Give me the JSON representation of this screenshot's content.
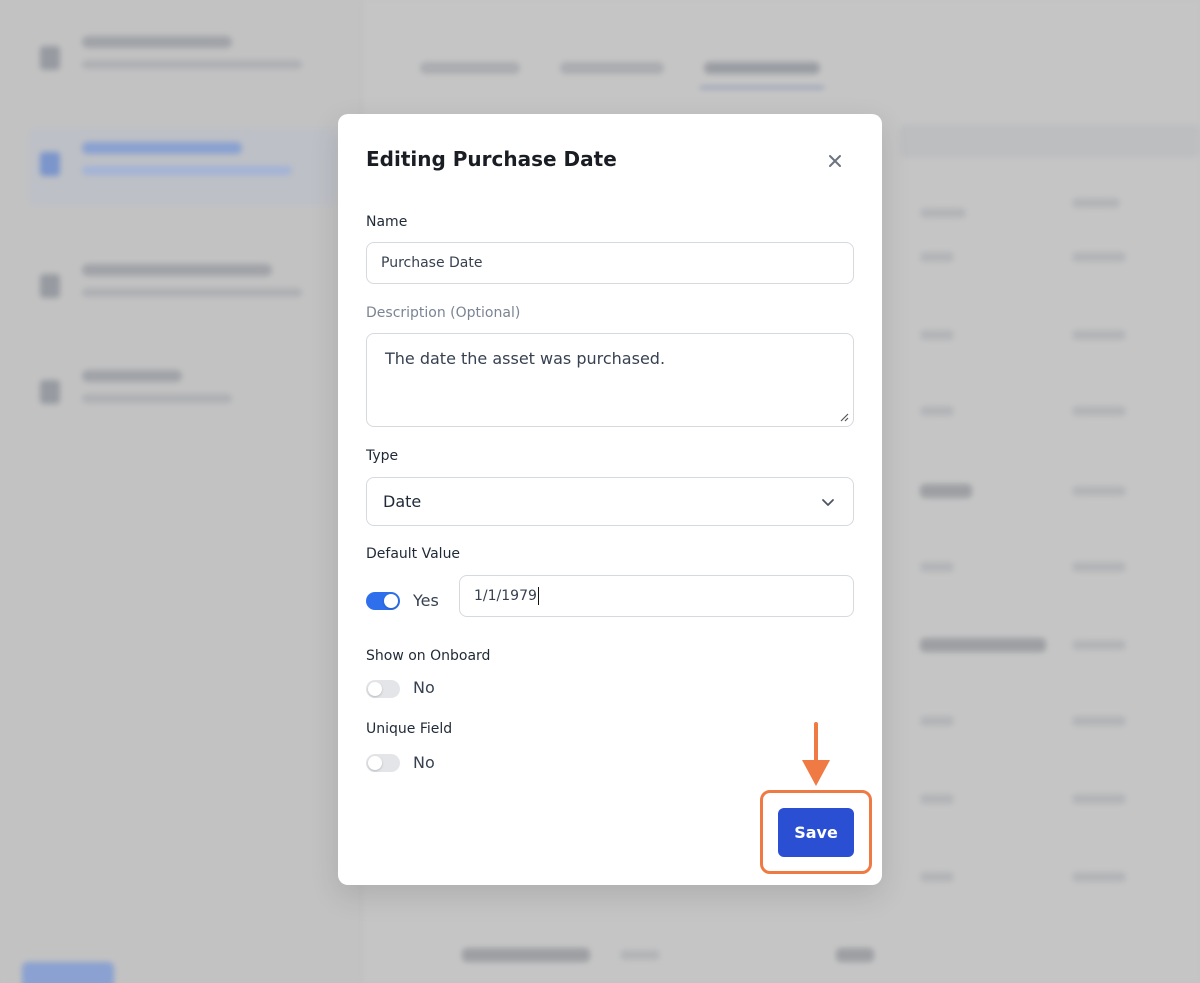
{
  "modal": {
    "title": "Editing Purchase Date",
    "name_label": "Name",
    "name_value": "Purchase Date",
    "description_label": "Description (Optional)",
    "description_value": "The date the asset was purchased.",
    "type_label": "Type",
    "type_value": "Date",
    "default_value_label": "Default Value",
    "default_toggle_text": "Yes",
    "default_value": "1/1/1979",
    "show_on_onboard_label": "Show on Onboard",
    "show_on_onboard_text": "No",
    "unique_field_label": "Unique Field",
    "unique_field_text": "No",
    "save_label": "Save"
  },
  "colors": {
    "accent": "#2a4fd2",
    "toggle_on": "#2f6fec",
    "annotation": "#f07a43"
  },
  "icons": {
    "close": "close-icon",
    "dropdown": "chevron-down-icon",
    "annotation_arrow": "arrow-down-icon"
  }
}
